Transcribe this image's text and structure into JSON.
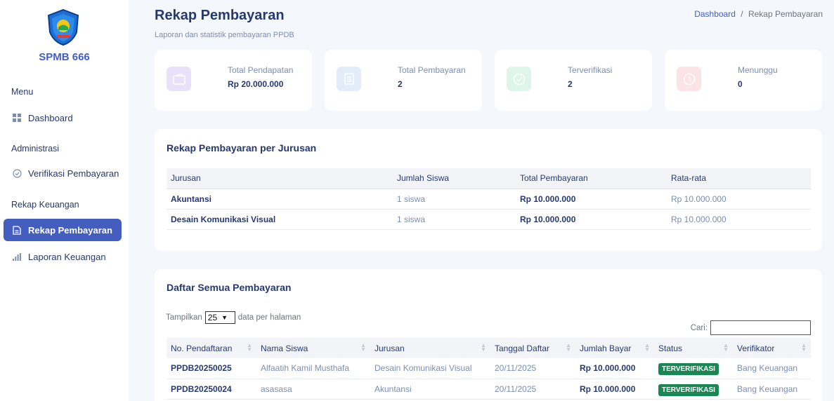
{
  "sidebar": {
    "brand": "SPMB 666",
    "sections": {
      "menu": "Menu",
      "administrasi": "Administrasi",
      "rekap": "Rekap Keuangan"
    },
    "items": {
      "dashboard": "Dashboard",
      "verifikasi": "Verifikasi Pembayaran",
      "rekap_pembayaran": "Rekap Pembayaran",
      "laporan": "Laporan Keuangan"
    }
  },
  "header": {
    "title": "Rekap Pembayaran",
    "subtitle": "Laporan dan statistik pembayaran PPDB",
    "breadcrumb": {
      "home": "Dashboard",
      "separator": "/",
      "current": "Rekap Pembayaran"
    }
  },
  "stats": [
    {
      "label": "Total Pendapatan",
      "value": "Rp 20.000.000",
      "icon": "wallet-icon",
      "color": "#e9e0fb"
    },
    {
      "label": "Total Pembayaran",
      "value": "2",
      "icon": "receipt-icon",
      "color": "#e3ecfb"
    },
    {
      "label": "Terverifikasi",
      "value": "2",
      "icon": "check-circle-icon",
      "color": "#ddf5ea"
    },
    {
      "label": "Menunggu",
      "value": "0",
      "icon": "clock-icon",
      "color": "#fbe3e6"
    }
  ],
  "per_jurusan": {
    "title": "Rekap Pembayaran per Jurusan",
    "columns": [
      "Jurusan",
      "Jumlah Siswa",
      "Total Pembayaran",
      "Rata-rata"
    ],
    "rows": [
      [
        "Akuntansi",
        "1 siswa",
        "Rp 10.000.000",
        "Rp 10.000.000"
      ],
      [
        "Desain Komunikasi Visual",
        "1 siswa",
        "Rp 10.000.000",
        "Rp 10.000.000"
      ]
    ]
  },
  "all_payments": {
    "title": "Daftar Semua Pembayaran",
    "length_prefix": "Tampilkan",
    "length_value": "25",
    "length_suffix": "data per halaman",
    "search_label": "Cari:",
    "columns": [
      "No. Pendaftaran",
      "Nama Siswa",
      "Jurusan",
      "Tanggal Daftar",
      "Jumlah Bayar",
      "Status",
      "Verifikator"
    ],
    "rows": [
      [
        "PPDB20250025",
        "Alfaatih Kamil Musthafa",
        "Desain Komunikasi Visual",
        "20/11/2025",
        "Rp 10.000.000",
        "TERVERIFIKASI",
        "Bang Keuangan"
      ],
      [
        "PPDB20250024",
        "asasasa",
        "Akuntansi",
        "20/11/2025",
        "Rp 10.000.000",
        "TERVERIFIKASI",
        "Bang Keuangan"
      ]
    ]
  },
  "colors": {
    "primary": "#435ebe",
    "success": "#198754",
    "background": "#f4f7fc"
  }
}
